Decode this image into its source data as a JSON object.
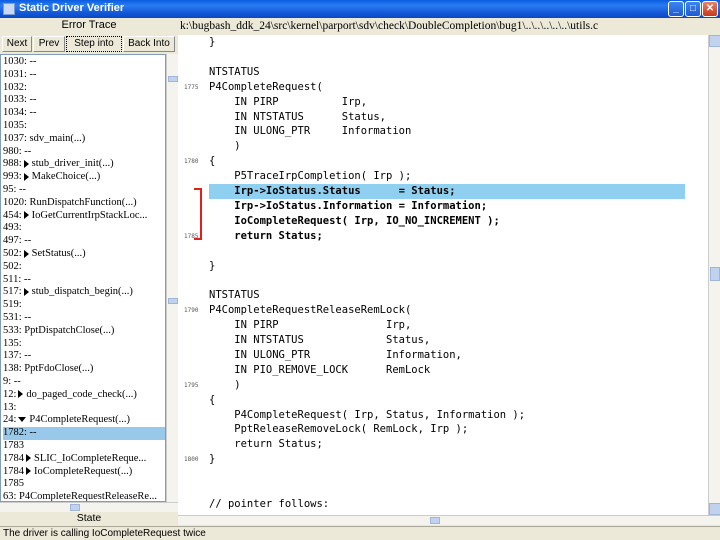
{
  "window": {
    "title": "Static Driver Verifier",
    "minimize_label": "_",
    "maximize_label": "□",
    "close_label": "✕"
  },
  "left_pane": {
    "title": "Error Trace",
    "buttons": {
      "next": "Next",
      "prev": "Prev",
      "step": "Step into",
      "back": "Back Into"
    },
    "rows": [
      {
        "text": "1030: --",
        "marker": "none",
        "selected": false
      },
      {
        "text": "1031: --",
        "marker": "none",
        "selected": false
      },
      {
        "text": "1032:",
        "marker": "none",
        "selected": false
      },
      {
        "text": "1033: --",
        "marker": "none",
        "selected": false
      },
      {
        "text": "1034: --",
        "marker": "none",
        "selected": false
      },
      {
        "text": "1035:",
        "marker": "none",
        "selected": false
      },
      {
        "text": "1037: sdv_main(...)",
        "marker": "none",
        "selected": false
      },
      {
        "text": "980: --",
        "marker": "none",
        "selected": false
      },
      {
        "text": "988:",
        "marker": "right",
        "label": "stub_driver_init(...)",
        "selected": false
      },
      {
        "text": "993:",
        "marker": "right",
        "label": "MakeChoice(...)",
        "selected": false
      },
      {
        "text": "95: --",
        "marker": "none",
        "selected": false
      },
      {
        "text": "1020: RunDispatchFunction(...)",
        "marker": "none",
        "selected": false
      },
      {
        "text": "454:",
        "marker": "right",
        "label": "IoGetCurrentIrpStackLoc...",
        "selected": false
      },
      {
        "text": "493:",
        "marker": "none",
        "selected": false
      },
      {
        "text": "497: --",
        "marker": "none",
        "selected": false
      },
      {
        "text": "502:",
        "marker": "right",
        "label": "SetStatus(...)",
        "selected": false
      },
      {
        "text": "502:",
        "marker": "none",
        "selected": false
      },
      {
        "text": "511: --",
        "marker": "none",
        "selected": false
      },
      {
        "text": "517:",
        "marker": "right",
        "label": "stub_dispatch_begin(...)",
        "selected": false
      },
      {
        "text": "519:",
        "marker": "none",
        "selected": false
      },
      {
        "text": "531: --",
        "marker": "none",
        "selected": false
      },
      {
        "text": "533: PptDispatchClose(...)",
        "marker": "none",
        "selected": false
      },
      {
        "text": "135:",
        "marker": "none",
        "selected": false
      },
      {
        "text": "137: --",
        "marker": "none",
        "selected": false
      },
      {
        "text": "138: PptFdoClose(...)",
        "marker": "none",
        "selected": false
      },
      {
        "text": "9: --",
        "marker": "none",
        "selected": false
      },
      {
        "text": "12:",
        "marker": "right",
        "label": "do_paged_code_check(...)",
        "selected": false
      },
      {
        "text": "13:",
        "marker": "none",
        "selected": false
      },
      {
        "text": "24:",
        "marker": "down",
        "label": "P4CompleteRequest(...)",
        "selected": false
      },
      {
        "text": "1782: --",
        "marker": "none",
        "selected": true
      },
      {
        "text": "1783",
        "marker": "none",
        "selected": false
      },
      {
        "text": "1784",
        "marker": "right",
        "label": "SLIC_IoCompleteReque...",
        "selected": false
      },
      {
        "text": "1784",
        "marker": "right",
        "label": "IoCompleteRequest(...)",
        "selected": false
      },
      {
        "text": "1785",
        "marker": "none",
        "selected": false
      },
      {
        "text": "63: P4CompleteRequestReleaseRe...",
        "marker": "none",
        "selected": false
      }
    ],
    "state_label": "State"
  },
  "editor": {
    "path": "k:\\bugbash_ddk_24\\src\\kernel\\parport\\sdv\\check\\DoubleCompletion\\bug1\\..\\..\\..\\..\\..\\utils.c",
    "gutter": [
      {
        "label": "1775",
        "line": 3
      },
      {
        "label": "1780",
        "line": 8
      },
      {
        "label": "1785",
        "line": 13
      },
      {
        "label": "1790",
        "line": 18
      },
      {
        "label": "1795",
        "line": 23
      },
      {
        "label": "1800",
        "line": 28
      }
    ],
    "lines": [
      {
        "text": "}",
        "style": "normal"
      },
      {
        "text": "",
        "style": "normal"
      },
      {
        "text": "NTSTATUS",
        "style": "normal"
      },
      {
        "text": "P4CompleteRequest(",
        "style": "normal"
      },
      {
        "text": "    IN PIRP          Irp,",
        "style": "normal"
      },
      {
        "text": "    IN NTSTATUS      Status,",
        "style": "normal"
      },
      {
        "text": "    IN ULONG_PTR     Information",
        "style": "normal"
      },
      {
        "text": "    )",
        "style": "normal"
      },
      {
        "text": "{",
        "style": "normal"
      },
      {
        "text": "    P5TraceIrpCompletion( Irp );",
        "style": "normal"
      },
      {
        "text": "    Irp->IoStatus.Status      = Status;",
        "style": "hl"
      },
      {
        "text": "    Irp->IoStatus.Information = Information;",
        "style": "bold"
      },
      {
        "text": "    IoCompleteRequest( Irp, IO_NO_INCREMENT );",
        "style": "bold"
      },
      {
        "text": "    return Status;",
        "style": "bold"
      },
      {
        "text": "",
        "style": "normal"
      },
      {
        "text": "}",
        "style": "normal"
      },
      {
        "text": "",
        "style": "normal"
      },
      {
        "text": "NTSTATUS",
        "style": "normal"
      },
      {
        "text": "P4CompleteRequestReleaseRemLock(",
        "style": "normal"
      },
      {
        "text": "    IN PIRP                 Irp,",
        "style": "normal"
      },
      {
        "text": "    IN NTSTATUS             Status,",
        "style": "normal"
      },
      {
        "text": "    IN ULONG_PTR            Information,",
        "style": "normal"
      },
      {
        "text": "    IN PIO_REMOVE_LOCK      RemLock",
        "style": "normal"
      },
      {
        "text": "    )",
        "style": "normal"
      },
      {
        "text": "{",
        "style": "normal"
      },
      {
        "text": "    P4CompleteRequest( Irp, Status, Information );",
        "style": "normal"
      },
      {
        "text": "    PptReleaseRemoveLock( RemLock, Irp );",
        "style": "normal"
      },
      {
        "text": "    return Status;",
        "style": "normal"
      },
      {
        "text": "}",
        "style": "normal"
      },
      {
        "text": "",
        "style": "normal"
      },
      {
        "text": "",
        "style": "normal"
      },
      {
        "text": "// pointer follows:",
        "style": "normal"
      }
    ]
  },
  "statusbar": {
    "text": "The driver is calling IoCompleteRequest twice"
  },
  "colors": {
    "selection": "#98c8ea",
    "highlight_line": "#8fd0f0",
    "marker_red": "#e0201c"
  }
}
